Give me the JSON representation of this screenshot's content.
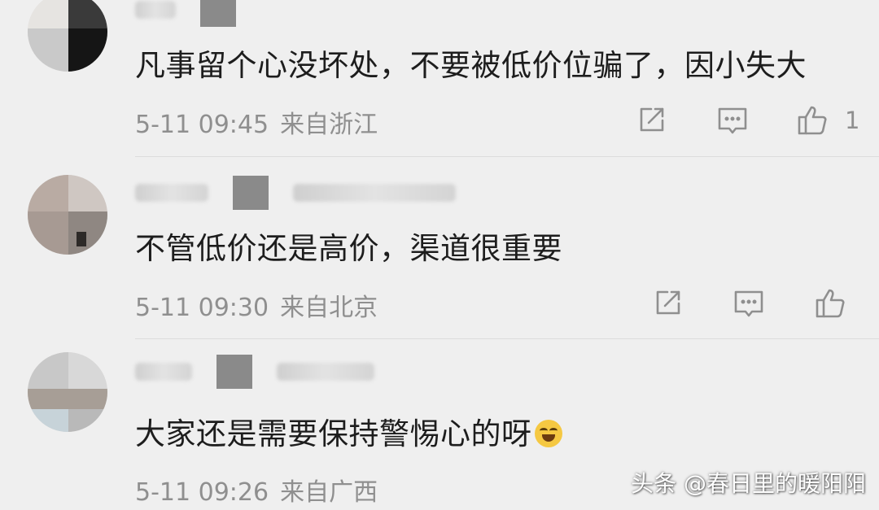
{
  "comments": [
    {
      "text": "凡事留个心没坏处，不要被低价位骗了，因小失大",
      "time": "5-11 09:45",
      "location": "来自浙江",
      "likes": "1"
    },
    {
      "text": "不管低价还是高价，渠道很重要",
      "time": "5-11 09:30",
      "location": "来自北京",
      "likes": ""
    },
    {
      "text": "大家还是需要保持警惕心的呀",
      "time": "5-11 09:26",
      "location": "来自广西",
      "likes": ""
    }
  ],
  "icons": [
    "share-icon",
    "reply-icon",
    "like-icon",
    "laughing-crying-emoji-icon"
  ],
  "watermark": "头条 @春日里的暖阳阳",
  "colors": {
    "background": "#efefef",
    "text": "#1d1d1d",
    "meta": "#8f8f8f"
  }
}
